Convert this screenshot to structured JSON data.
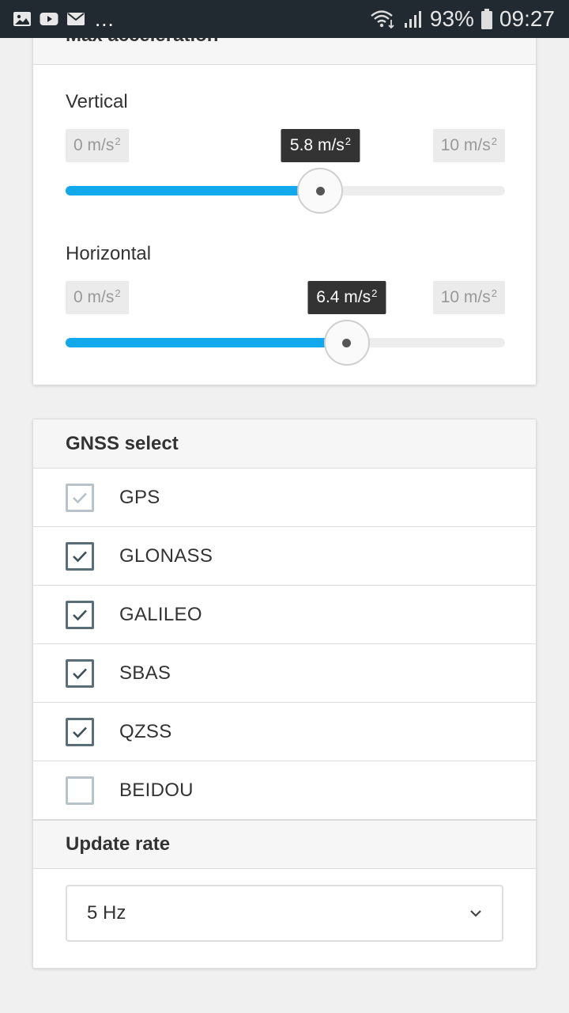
{
  "status_bar": {
    "icons": [
      "image-icon",
      "youtube-icon",
      "mail-icon"
    ],
    "more": "...",
    "battery_percent": "93%",
    "time": "09:27"
  },
  "acceleration": {
    "header": "Max acceleration",
    "vertical": {
      "label": "Vertical",
      "min_label": "0 m/s",
      "max_label": "10 m/s",
      "value_label": "5.8 m/s",
      "exponent": "2",
      "min": 0,
      "max": 10,
      "value": 5.8
    },
    "horizontal": {
      "label": "Horizontal",
      "min_label": "0 m/s",
      "max_label": "10 m/s",
      "value_label": "6.4 m/s",
      "exponent": "2",
      "min": 0,
      "max": 10,
      "value": 6.4
    },
    "accent_color": "#12a8ec"
  },
  "gnss": {
    "header": "GNSS select",
    "items": [
      {
        "label": "GPS",
        "checked": true,
        "disabled": true
      },
      {
        "label": "GLONASS",
        "checked": true,
        "disabled": false
      },
      {
        "label": "GALILEO",
        "checked": true,
        "disabled": false
      },
      {
        "label": "SBAS",
        "checked": true,
        "disabled": false
      },
      {
        "label": "QZSS",
        "checked": true,
        "disabled": false
      },
      {
        "label": "BEIDOU",
        "checked": false,
        "disabled": false
      }
    ]
  },
  "update_rate": {
    "header": "Update rate",
    "selected": "5 Hz"
  }
}
